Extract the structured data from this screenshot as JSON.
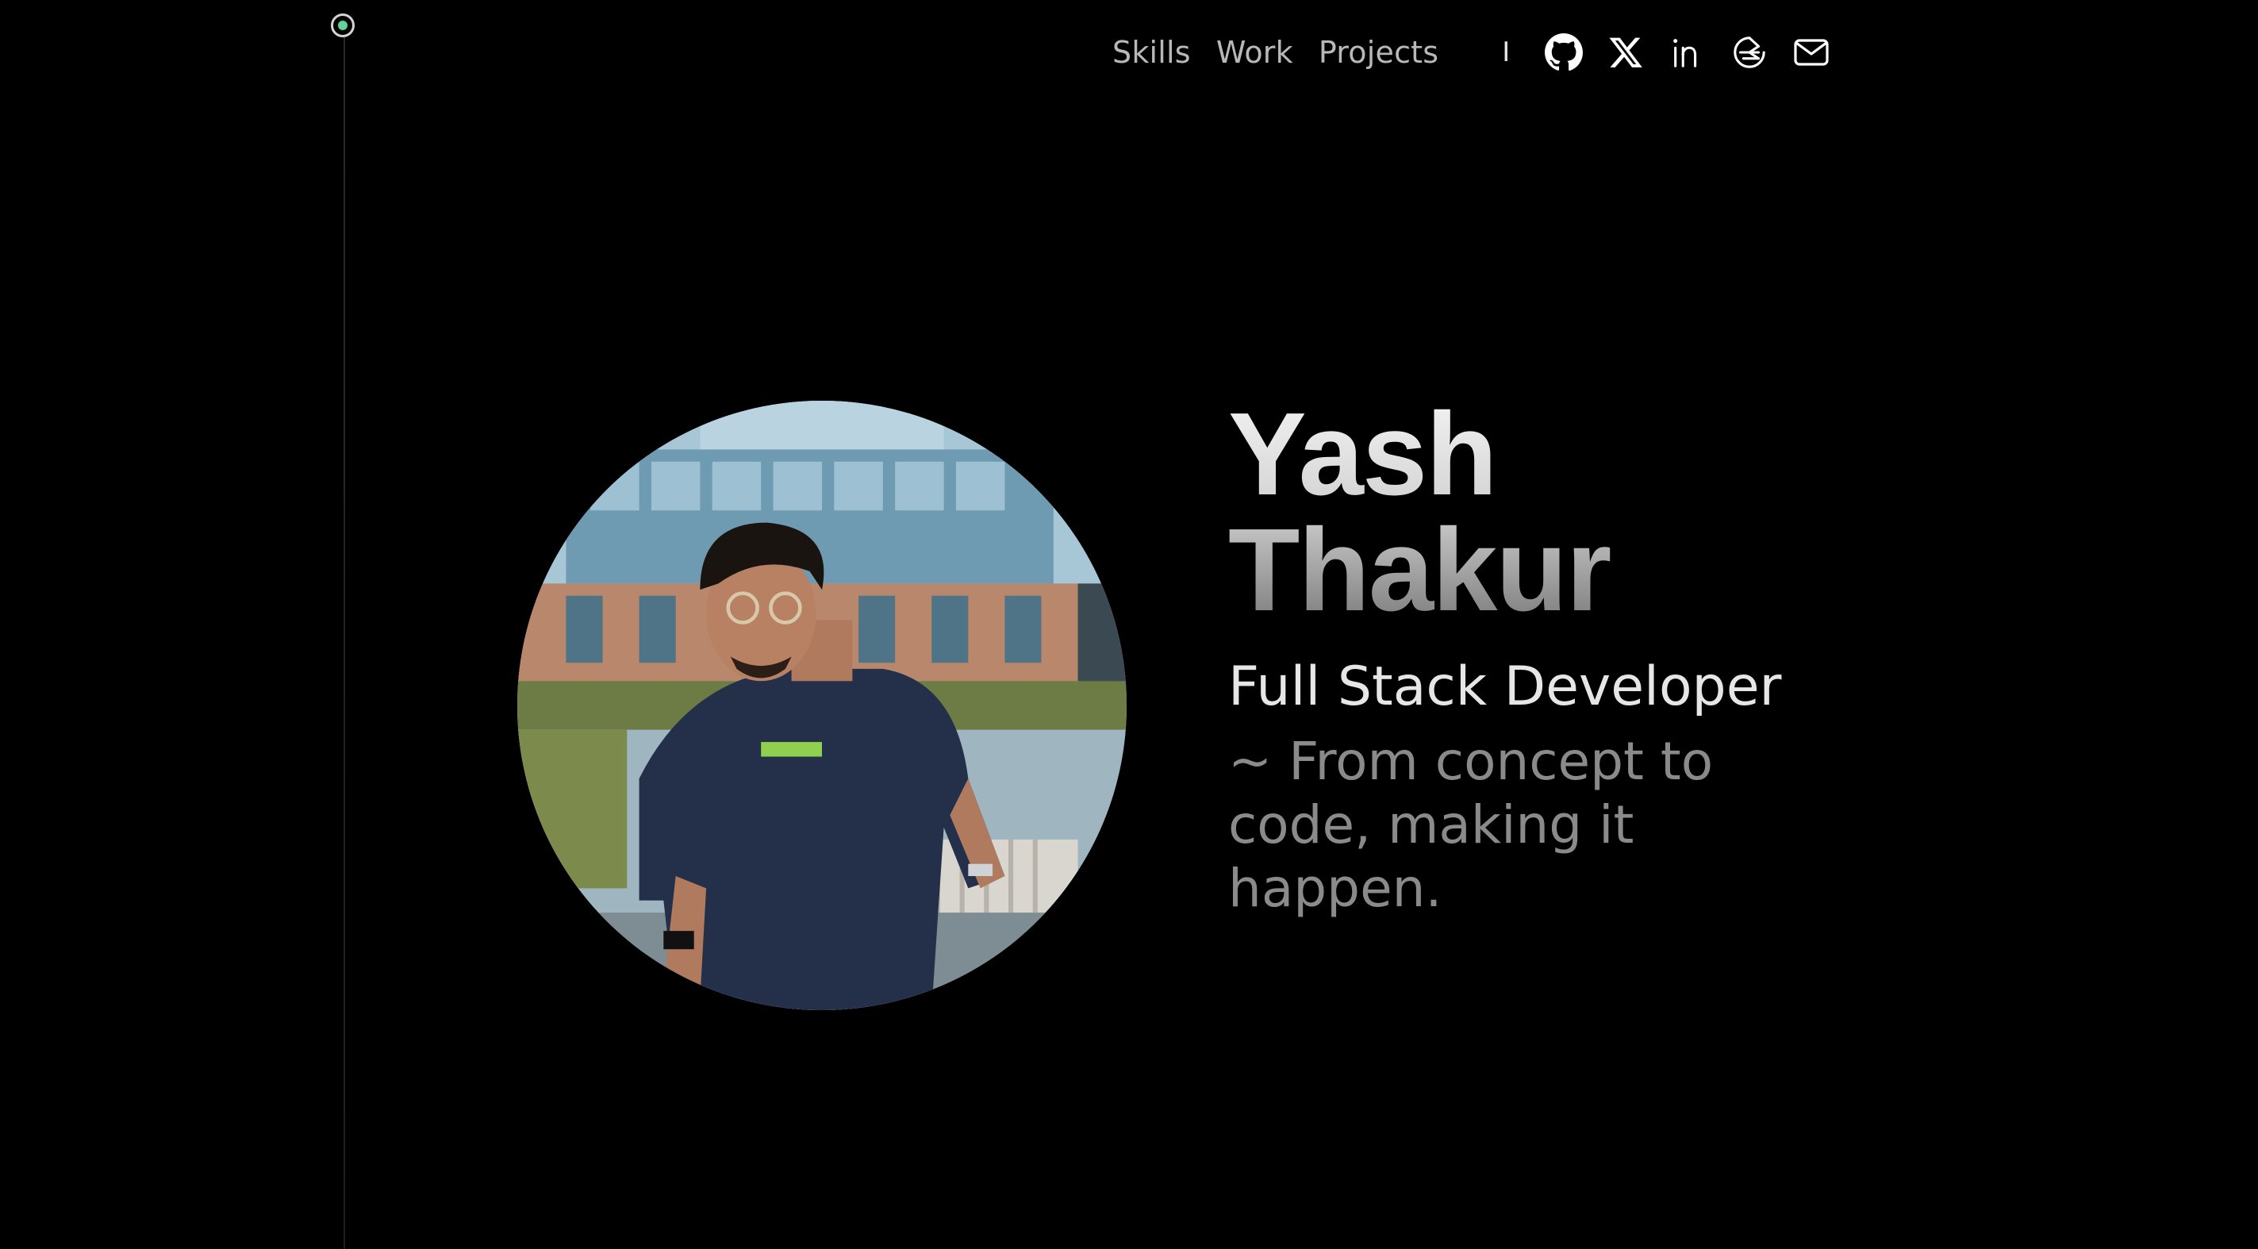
{
  "nav": {
    "links": [
      {
        "label": "Skills"
      },
      {
        "label": "Work"
      },
      {
        "label": "Projects"
      }
    ],
    "separator": "I",
    "social": [
      {
        "name": "github-icon"
      },
      {
        "name": "x-twitter-icon"
      },
      {
        "name": "linkedin-icon"
      },
      {
        "name": "hashnode-icon"
      },
      {
        "name": "mail-icon"
      }
    ]
  },
  "hero": {
    "name_line1": "Yash",
    "name_line2": "Thakur",
    "role": "Full Stack Developer",
    "tagline": "~ From concept to code, making it happen."
  },
  "colors": {
    "background": "#000000",
    "accent": "#5fd39a",
    "nav_text": "#b8b8b8",
    "tagline_text": "#8a8a8a"
  }
}
